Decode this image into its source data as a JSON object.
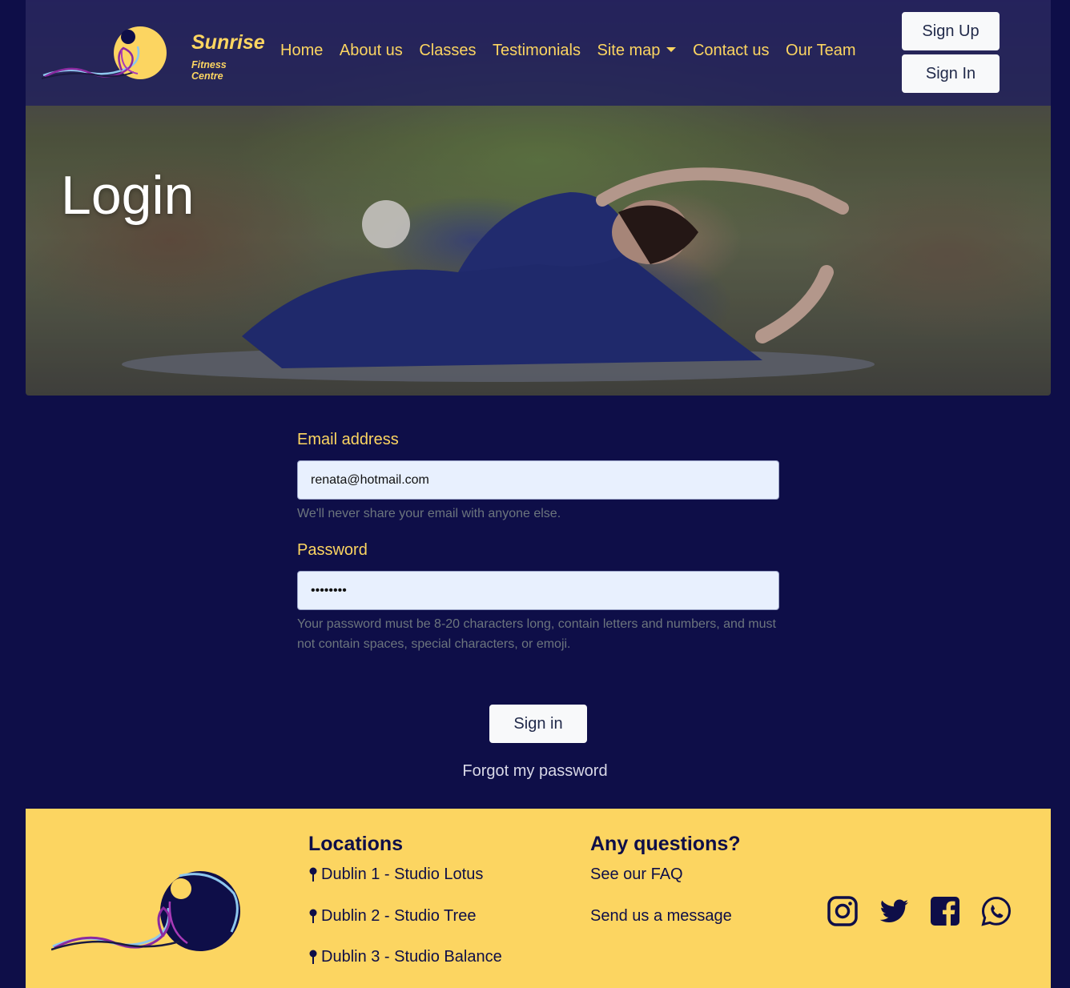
{
  "brand": {
    "name": "Sunrise",
    "subtitle": "Fitness Centre"
  },
  "nav": {
    "links": [
      "Home",
      "About us",
      "Classes",
      "Testimonials",
      "Site map",
      "Contact us",
      "Our Team"
    ],
    "dropdown_index": 4,
    "signup_label": "Sign Up",
    "signin_label": "Sign In"
  },
  "hero": {
    "title": "Login"
  },
  "form": {
    "email_label": "Email address",
    "email_value": "renata@hotmail.com",
    "email_hint": "We'll never share your email with anyone else.",
    "password_label": "Password",
    "password_value": "••••••••",
    "password_hint": "Your password must be 8-20 characters long, contain letters and numbers, and must not contain spaces, special characters, or emoji.",
    "submit_label": "Sign in",
    "forgot_label": "Forgot my password"
  },
  "footer": {
    "locations_heading": "Locations",
    "locations": [
      "Dublin 1 - Studio Lotus",
      "Dublin 2 - Studio Tree",
      "Dublin 3 - Studio Balance"
    ],
    "questions_heading": "Any questions?",
    "questions": [
      "See our FAQ",
      "Send us a message"
    ],
    "socials": [
      "instagram-icon",
      "twitter-icon",
      "facebook-icon",
      "whatsapp-icon"
    ]
  },
  "colors": {
    "background": "#0e0e48",
    "accent": "#fcd561",
    "light": "#f8f9fa"
  }
}
